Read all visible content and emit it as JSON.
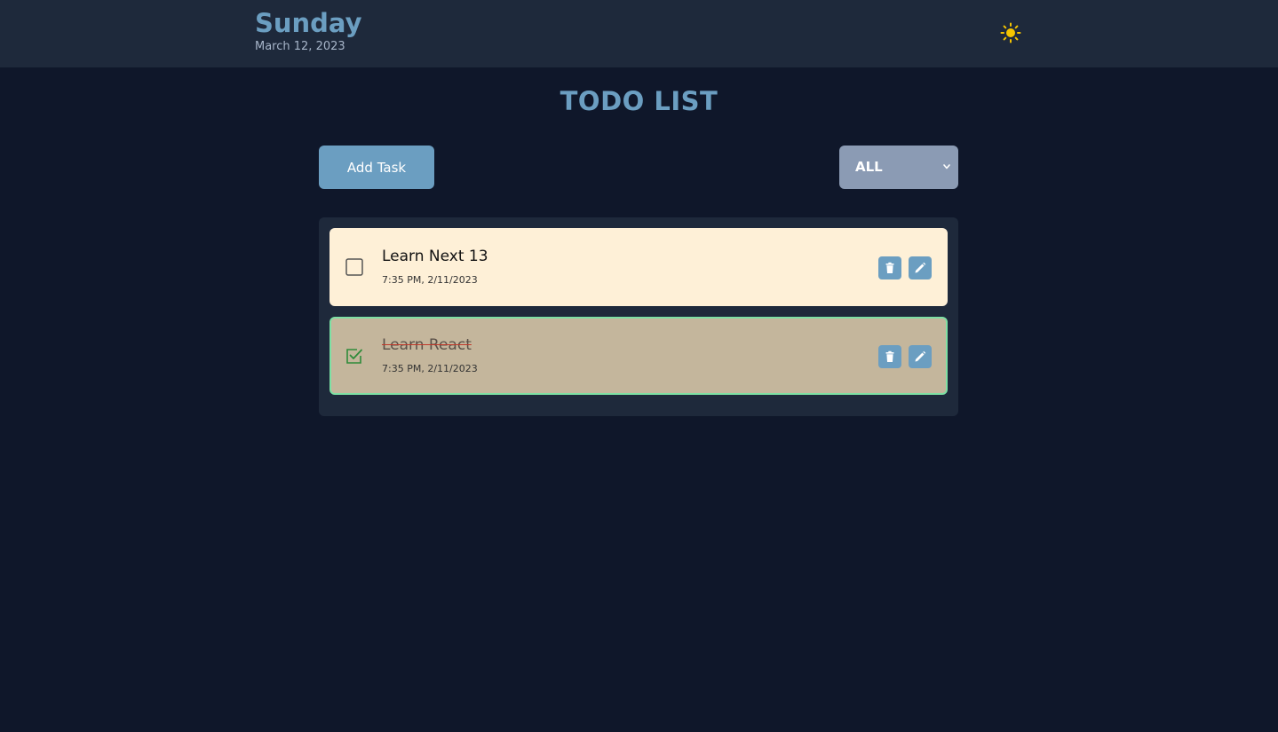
{
  "header": {
    "day": "Sunday",
    "date": "March 12, 2023",
    "theme_icon": "sun-icon",
    "theme_icon_color": "#f5c400"
  },
  "page": {
    "title": "TODO LIST"
  },
  "toolbar": {
    "add_label": "Add Task",
    "filter_value": "ALL"
  },
  "todos": [
    {
      "title": "Learn Next 13",
      "time": "7:35 PM, 2/11/2023",
      "completed": false
    },
    {
      "title": "Learn React",
      "time": "7:35 PM, 2/11/2023",
      "completed": true
    }
  ],
  "colors": {
    "accent": "#6b9ec1",
    "background": "#0f172a",
    "panel": "#1e293b",
    "todo_pending": "#fef0d7",
    "todo_done": "#c4b69c",
    "done_border": "#7ee0a4",
    "check_color": "#2e8b3a"
  },
  "icons": {
    "delete": "trash-icon",
    "edit": "pencil-icon",
    "unchecked": "checkbox-unchecked-icon",
    "checked": "checkbox-checked-icon",
    "filter": "chevron-down-icon"
  }
}
